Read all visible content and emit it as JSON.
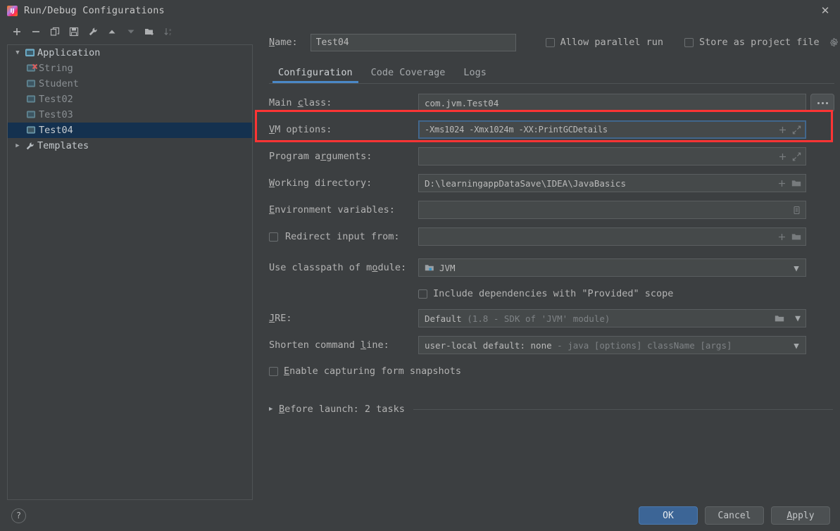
{
  "window": {
    "title": "Run/Debug Configurations",
    "app_icon": "intellij-idea-icon",
    "close_icon": "close-icon"
  },
  "toolbar": {
    "buttons": [
      {
        "name": "add-configuration",
        "icon": "plus-icon",
        "dim": false
      },
      {
        "name": "remove-configuration",
        "icon": "minus-icon",
        "dim": false
      },
      {
        "name": "copy-configuration",
        "icon": "copy-icon",
        "dim": false
      },
      {
        "name": "save-configuration",
        "icon": "save-icon",
        "dim": false
      },
      {
        "name": "edit-templates",
        "icon": "wrench-icon",
        "dim": false
      },
      {
        "name": "move-up",
        "icon": "arrow-up-icon",
        "dim": false
      },
      {
        "name": "move-down",
        "icon": "arrow-down-icon",
        "dim": true
      },
      {
        "name": "move-into-folder",
        "icon": "folder-add-icon",
        "dim": false
      },
      {
        "name": "sort-alphabetically",
        "icon": "sort-az-icon",
        "dim": true
      }
    ]
  },
  "tree": {
    "nodes": [
      {
        "label": "Application",
        "level": 0,
        "twisty": "expanded",
        "icon": "application-icon",
        "selected": false,
        "error": false
      },
      {
        "label": "String",
        "level": 1,
        "twisty": "none",
        "icon": "config-icon",
        "selected": false,
        "error": true
      },
      {
        "label": "Student",
        "level": 1,
        "twisty": "none",
        "icon": "config-icon",
        "selected": false,
        "error": false
      },
      {
        "label": "Test02",
        "level": 1,
        "twisty": "none",
        "icon": "config-icon",
        "selected": false,
        "error": false
      },
      {
        "label": "Test03",
        "level": 1,
        "twisty": "none",
        "icon": "config-icon",
        "selected": false,
        "error": false
      },
      {
        "label": "Test04",
        "level": 1,
        "twisty": "none",
        "icon": "config-icon",
        "selected": true,
        "error": false
      },
      {
        "label": "Templates",
        "level": 0,
        "twisty": "collapsed",
        "icon": "wrench-icon",
        "selected": false,
        "error": false
      }
    ]
  },
  "header": {
    "name_label": "Name:",
    "name_value": "Test04",
    "allow_parallel_run_label": "Allow parallel run",
    "allow_parallel_run_checked": false,
    "store_as_project_file_label": "Store as project file",
    "store_as_project_file_checked": false,
    "store_gear_icon": "gear-icon"
  },
  "tabs": [
    {
      "label": "Configuration",
      "active": true
    },
    {
      "label": "Code Coverage",
      "active": false
    },
    {
      "label": "Logs",
      "active": false
    }
  ],
  "form": {
    "main_class": {
      "label": "Main class:",
      "value": "com.jvm.Test04",
      "browse_icon": "ellipsis-icon"
    },
    "vm_options": {
      "label": "VM options:",
      "value": "-Xms1024 -Xmx1024m -XX:PrintGCDetails",
      "focused": true,
      "icons": [
        "macro-plus-icon",
        "expand-icon"
      ]
    },
    "program_arguments": {
      "label": "Program arguments:",
      "value": "",
      "icons": [
        "macro-plus-icon",
        "expand-icon"
      ]
    },
    "working_directory": {
      "label": "Working directory:",
      "value": "D:\\learningappDataSave\\IDEA\\JavaBasics",
      "icons": [
        "macro-plus-icon",
        "folder-icon"
      ]
    },
    "environment_variables": {
      "label": "Environment variables:",
      "value": "",
      "icons": [
        "list-edit-icon"
      ]
    },
    "redirect_input": {
      "label": "Redirect input from:",
      "checked": false,
      "value": "",
      "icons": [
        "macro-plus-icon",
        "folder-icon"
      ]
    },
    "use_classpath_of_module": {
      "label": "Use classpath of module:",
      "value": "JVM",
      "item_icon": "module-icon",
      "caret_icon": "chevron-down-icon"
    },
    "include_provided_dependencies": {
      "label": "Include dependencies with \"Provided\" scope",
      "checked": false
    },
    "jre": {
      "label": "JRE:",
      "value": "Default",
      "value_detail": "(1.8 - SDK of 'JVM' module)",
      "folder_icon": "folder-icon",
      "caret_icon": "chevron-down-icon"
    },
    "shorten_command_line": {
      "label": "Shorten command line:",
      "value": "user-local default: none",
      "value_detail": "- java [options] className [args]",
      "caret_icon": "chevron-down-icon"
    },
    "enable_capturing_form_snapshots": {
      "label": "Enable capturing form snapshots",
      "checked": false
    }
  },
  "before_launch": {
    "label": "Before launch: 2 tasks",
    "twisty": "collapsed"
  },
  "footer": {
    "help_label": "?",
    "ok_label": "OK",
    "cancel_label": "Cancel",
    "apply_label": "Apply"
  },
  "annotation": {
    "target": "vm-options-row",
    "color": "#fe3434"
  },
  "colors": {
    "background": "#3c3f41",
    "field_background": "#45494a",
    "accent_blue": "#4a88c7",
    "selection_blue": "#14314f",
    "primary_button": "#3c6596",
    "annotation_red": "#fe3434"
  }
}
